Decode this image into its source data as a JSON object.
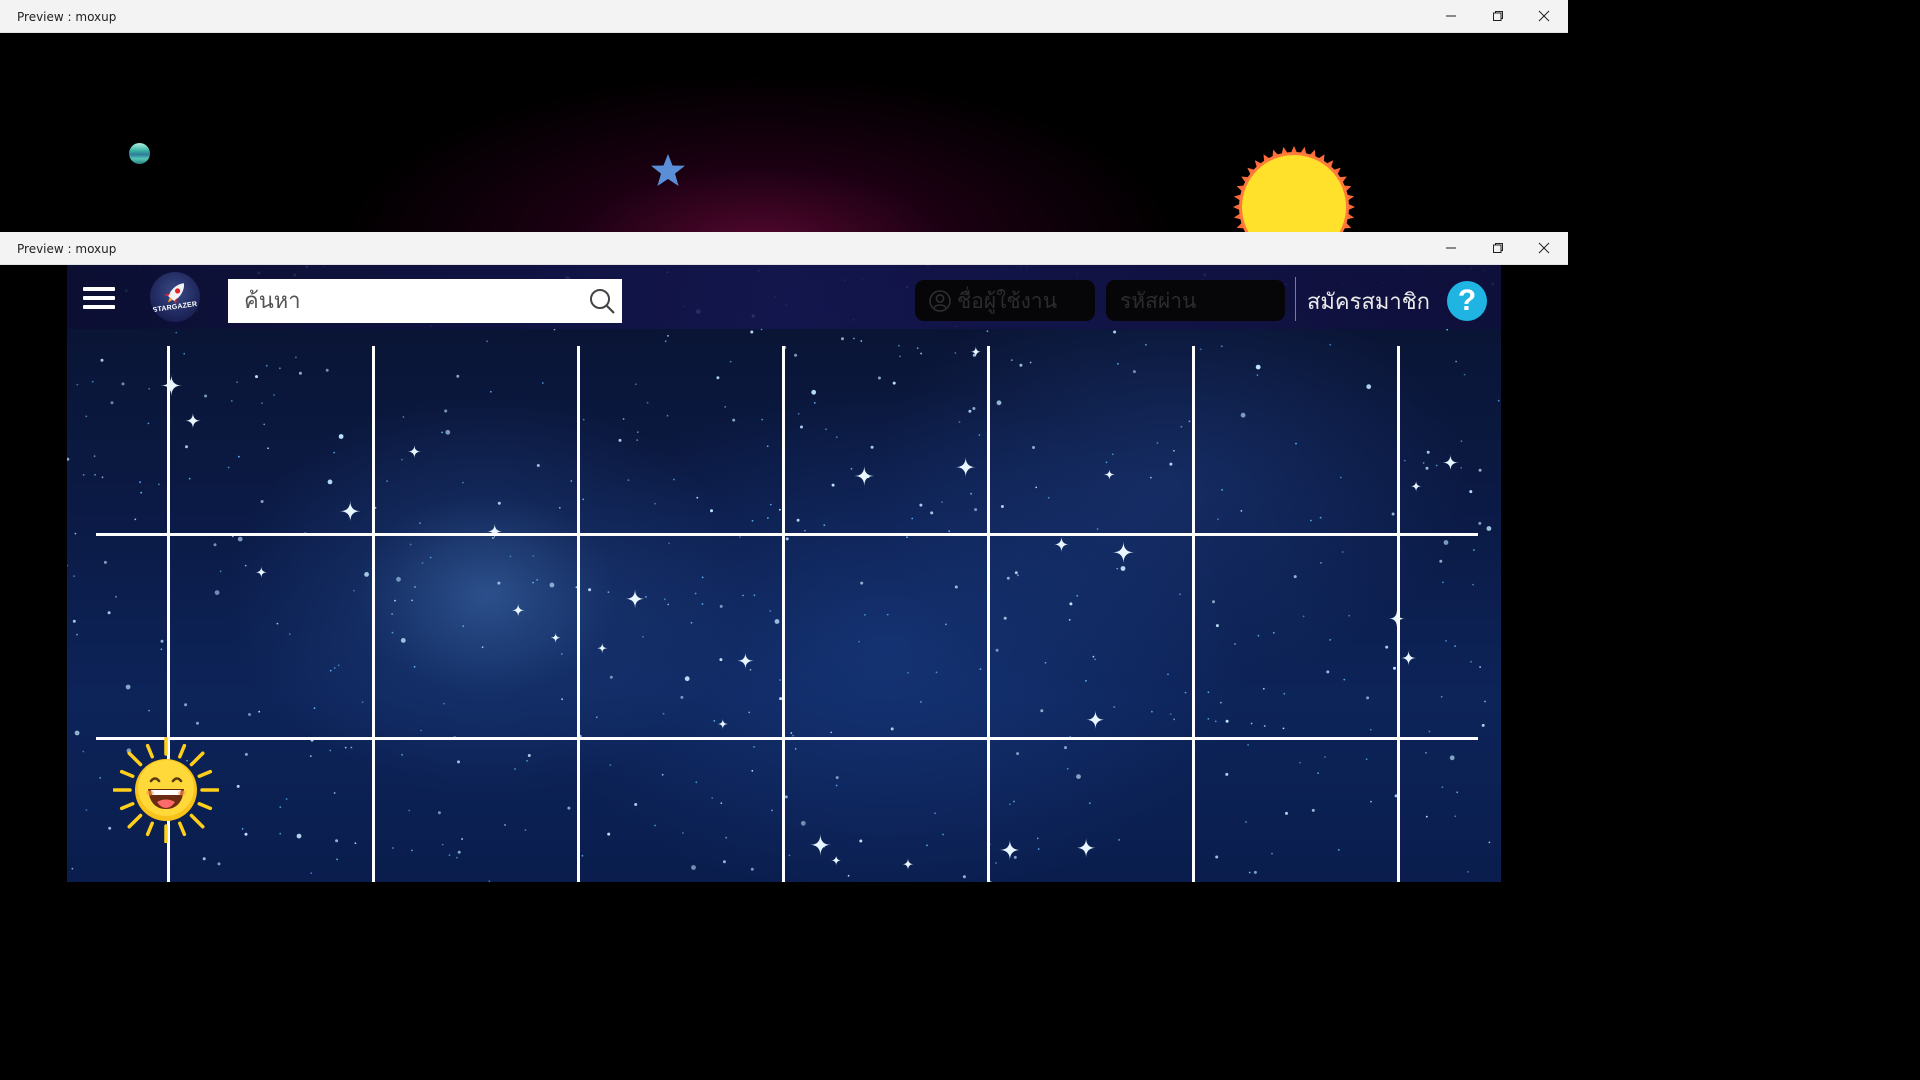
{
  "windows": [
    {
      "title": "Preview : moxup",
      "controls": {
        "minimize_icon": "minimize-icon",
        "maximize_icon": "restore-icon",
        "close_icon": "close-icon"
      }
    },
    {
      "title": "Preview : moxup",
      "controls": {
        "minimize_icon": "minimize-icon",
        "maximize_icon": "restore-icon",
        "close_icon": "close-icon"
      }
    }
  ],
  "scene1": {
    "elements": [
      "planet",
      "star",
      "sun"
    ]
  },
  "app": {
    "menu_icon": "hamburger-menu-icon",
    "logo": {
      "text": "STARGAZER",
      "icon": "rocket-icon"
    },
    "search": {
      "placeholder": "ค้นหา",
      "value": "",
      "icon": "search-icon"
    },
    "login": {
      "username_placeholder": "ชื่อผู้ใช้งาน",
      "password_placeholder": "รหัสผ่าน",
      "user_icon": "user-icon"
    },
    "register_label": "สมัครสมาชิก",
    "help_label": "?"
  },
  "grid": {
    "columns": 7,
    "rows": 3
  },
  "character": "laughing-sun-icon",
  "colors": {
    "titlebar": "#f3f3f3",
    "help_button": "#20b4e2",
    "sun": "#ffe12b",
    "sun_outline": "#ff7a3a",
    "space_dark": "#0a1330",
    "space_mid": "#0d2459"
  }
}
